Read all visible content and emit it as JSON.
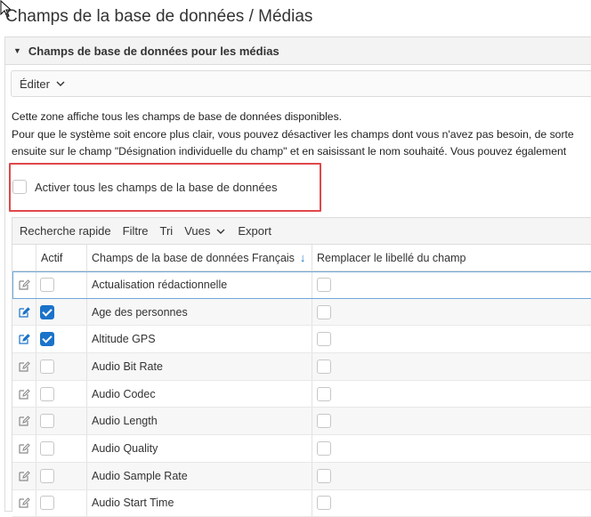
{
  "page": {
    "title": "Champs de la base de données / Médias"
  },
  "section": {
    "header": "Champs de base de données pour les médias",
    "edit_menu": "Éditer"
  },
  "description": {
    "line1": "Cette zone affiche tous les champs de base de données disponibles.",
    "line2": "Pour que le système soit encore plus clair, vous pouvez désactiver les champs dont vous n'avez pas besoin, de sorte",
    "line3": "ensuite sur le champ \"Désignation individuelle du champ\" et en saisissant le nom souhaité. Vous pouvez également"
  },
  "activate_all": {
    "label": "Activer tous les champs de la base de données",
    "checked": false
  },
  "toolbar": {
    "quick_search": "Recherche rapide",
    "filter": "Filtre",
    "sort": "Tri",
    "views": "Vues",
    "export": "Export"
  },
  "table": {
    "headers": {
      "active": "Actif",
      "field": "Champs de la base de données Français",
      "replace": "Remplacer le libellé du champ"
    },
    "rows": [
      {
        "name": "Actualisation rédactionnelle",
        "active": false,
        "edit_active": false
      },
      {
        "name": "Age des personnes",
        "active": true,
        "edit_active": true
      },
      {
        "name": "Altitude GPS",
        "active": true,
        "edit_active": true
      },
      {
        "name": "Audio Bit Rate",
        "active": false,
        "edit_active": false
      },
      {
        "name": "Audio Codec",
        "active": false,
        "edit_active": false
      },
      {
        "name": "Audio Length",
        "active": false,
        "edit_active": false
      },
      {
        "name": "Audio Quality",
        "active": false,
        "edit_active": false
      },
      {
        "name": "Audio Sample Rate",
        "active": false,
        "edit_active": false
      },
      {
        "name": "Audio Start Time",
        "active": false,
        "edit_active": false
      }
    ]
  },
  "colors": {
    "accent": "#1a73c9",
    "highlight_box": "#e0484b",
    "icon_inactive": "#8a8a8a"
  }
}
